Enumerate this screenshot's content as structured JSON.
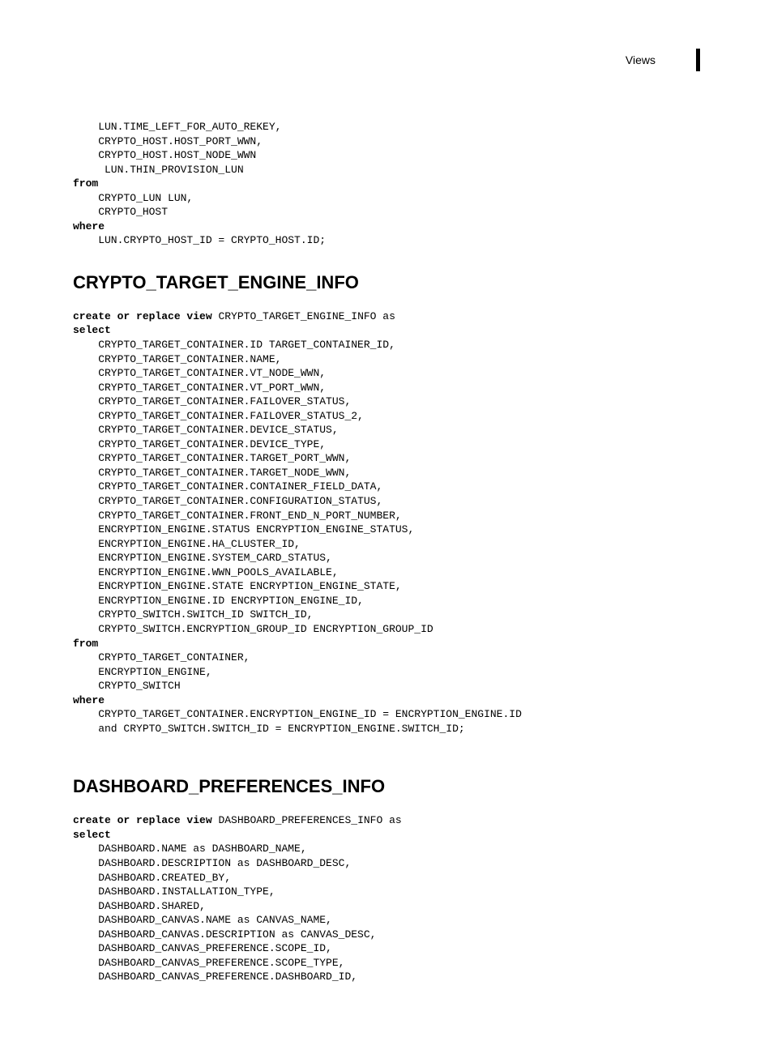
{
  "header": {
    "label": "Views"
  },
  "block1": {
    "lines": [
      "    LUN.TIME_LEFT_FOR_AUTO_REKEY,",
      "    CRYPTO_HOST.HOST_PORT_WWN,",
      "    CRYPTO_HOST.HOST_NODE_WWN",
      "     LUN.THIN_PROVISION_LUN"
    ],
    "kw_from": "from",
    "from_lines": [
      "    CRYPTO_LUN LUN,",
      "    CRYPTO_HOST"
    ],
    "kw_where": "where",
    "where_lines": [
      "    LUN.CRYPTO_HOST_ID = CRYPTO_HOST.ID;"
    ]
  },
  "section2": {
    "title": "CRYPTO_TARGET_ENGINE_INFO",
    "create_prefix": "create or replace view ",
    "create_name": "CRYPTO_TARGET_ENGINE_INFO as",
    "kw_select": "select",
    "select_lines": [
      "    CRYPTO_TARGET_CONTAINER.ID TARGET_CONTAINER_ID,",
      "    CRYPTO_TARGET_CONTAINER.NAME,",
      "    CRYPTO_TARGET_CONTAINER.VT_NODE_WWN,",
      "    CRYPTO_TARGET_CONTAINER.VT_PORT_WWN,",
      "    CRYPTO_TARGET_CONTAINER.FAILOVER_STATUS,",
      "    CRYPTO_TARGET_CONTAINER.FAILOVER_STATUS_2,",
      "    CRYPTO_TARGET_CONTAINER.DEVICE_STATUS,",
      "    CRYPTO_TARGET_CONTAINER.DEVICE_TYPE,",
      "    CRYPTO_TARGET_CONTAINER.TARGET_PORT_WWN,",
      "    CRYPTO_TARGET_CONTAINER.TARGET_NODE_WWN,",
      "    CRYPTO_TARGET_CONTAINER.CONTAINER_FIELD_DATA,",
      "    CRYPTO_TARGET_CONTAINER.CONFIGURATION_STATUS,",
      "    CRYPTO_TARGET_CONTAINER.FRONT_END_N_PORT_NUMBER,",
      "    ENCRYPTION_ENGINE.STATUS ENCRYPTION_ENGINE_STATUS,",
      "    ENCRYPTION_ENGINE.HA_CLUSTER_ID,",
      "    ENCRYPTION_ENGINE.SYSTEM_CARD_STATUS,",
      "    ENCRYPTION_ENGINE.WWN_POOLS_AVAILABLE,",
      "    ENCRYPTION_ENGINE.STATE ENCRYPTION_ENGINE_STATE,",
      "    ENCRYPTION_ENGINE.ID ENCRYPTION_ENGINE_ID,",
      "    CRYPTO_SWITCH.SWITCH_ID SWITCH_ID,",
      "    CRYPTO_SWITCH.ENCRYPTION_GROUP_ID ENCRYPTION_GROUP_ID"
    ],
    "kw_from": "from",
    "from_lines": [
      "    CRYPTO_TARGET_CONTAINER,",
      "    ENCRYPTION_ENGINE,",
      "    CRYPTO_SWITCH"
    ],
    "kw_where": "where",
    "where_lines": [
      "    CRYPTO_TARGET_CONTAINER.ENCRYPTION_ENGINE_ID = ENCRYPTION_ENGINE.ID",
      "    and CRYPTO_SWITCH.SWITCH_ID = ENCRYPTION_ENGINE.SWITCH_ID;"
    ]
  },
  "section3": {
    "title": "DASHBOARD_PREFERENCES_INFO",
    "create_prefix": "create or replace view ",
    "create_name": "DASHBOARD_PREFERENCES_INFO as",
    "kw_select": "select",
    "select_lines": [
      "    DASHBOARD.NAME as DASHBOARD_NAME,",
      "    DASHBOARD.DESCRIPTION as DASHBOARD_DESC,",
      "    DASHBOARD.CREATED_BY,",
      "    DASHBOARD.INSTALLATION_TYPE,",
      "    DASHBOARD.SHARED,",
      "    DASHBOARD_CANVAS.NAME as CANVAS_NAME,",
      "    DASHBOARD_CANVAS.DESCRIPTION as CANVAS_DESC,",
      "    DASHBOARD_CANVAS_PREFERENCE.SCOPE_ID,",
      "    DASHBOARD_CANVAS_PREFERENCE.SCOPE_TYPE,",
      "    DASHBOARD_CANVAS_PREFERENCE.DASHBOARD_ID,"
    ]
  }
}
